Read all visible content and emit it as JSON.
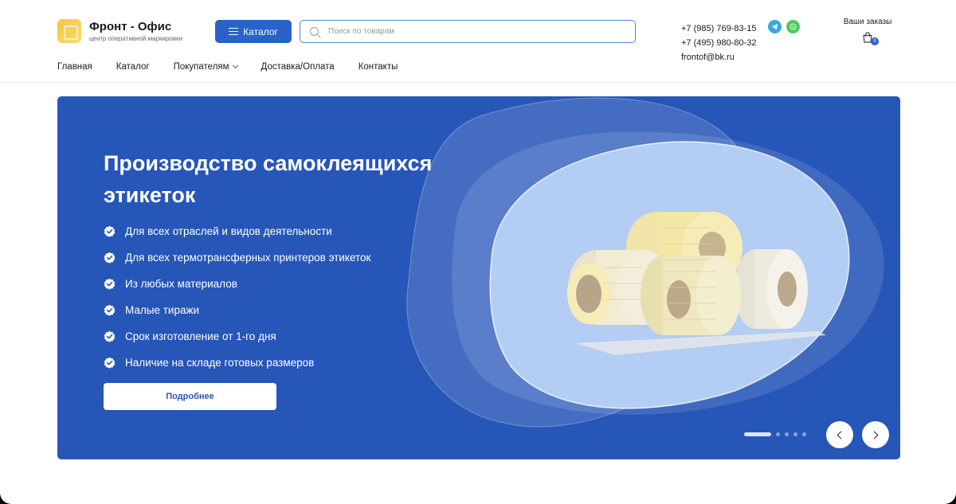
{
  "brand": {
    "title": "Фронт - Офис",
    "subtitle": "центр оперативной маркировки"
  },
  "header": {
    "catalog_label": "Каталог",
    "search_placeholder": "Поиск по товарам",
    "phones": [
      "+7 (985) 769-83-15",
      "+7 (495) 980-80-32"
    ],
    "email": "frontof@bk.ru",
    "orders_label": "Ваши заказы",
    "cart_count": "0"
  },
  "nav": [
    {
      "label": "Главная"
    },
    {
      "label": "Каталог"
    },
    {
      "label": "Покупателям",
      "has_dropdown": true
    },
    {
      "label": "Доставка/Оплата"
    },
    {
      "label": "Контакты"
    }
  ],
  "banner": {
    "headline": "Производство самоклеящихся этикеток",
    "features": [
      "Для всех отраслей и видов деятельности",
      "Для всех термотрансферных принтеров этикеток",
      "Из любых материалов",
      "Малые тиражи",
      "Срок изготовление от 1-го дня",
      "Наличие на складе готовых размеров"
    ],
    "button_label": "Подробнее",
    "slides_total": 5,
    "active_slide": 1
  },
  "colors": {
    "accent": "#2a62c9",
    "banner_bg": "#2656b8",
    "telegram": "#3aa6e0",
    "whatsapp": "#4cc95e"
  }
}
